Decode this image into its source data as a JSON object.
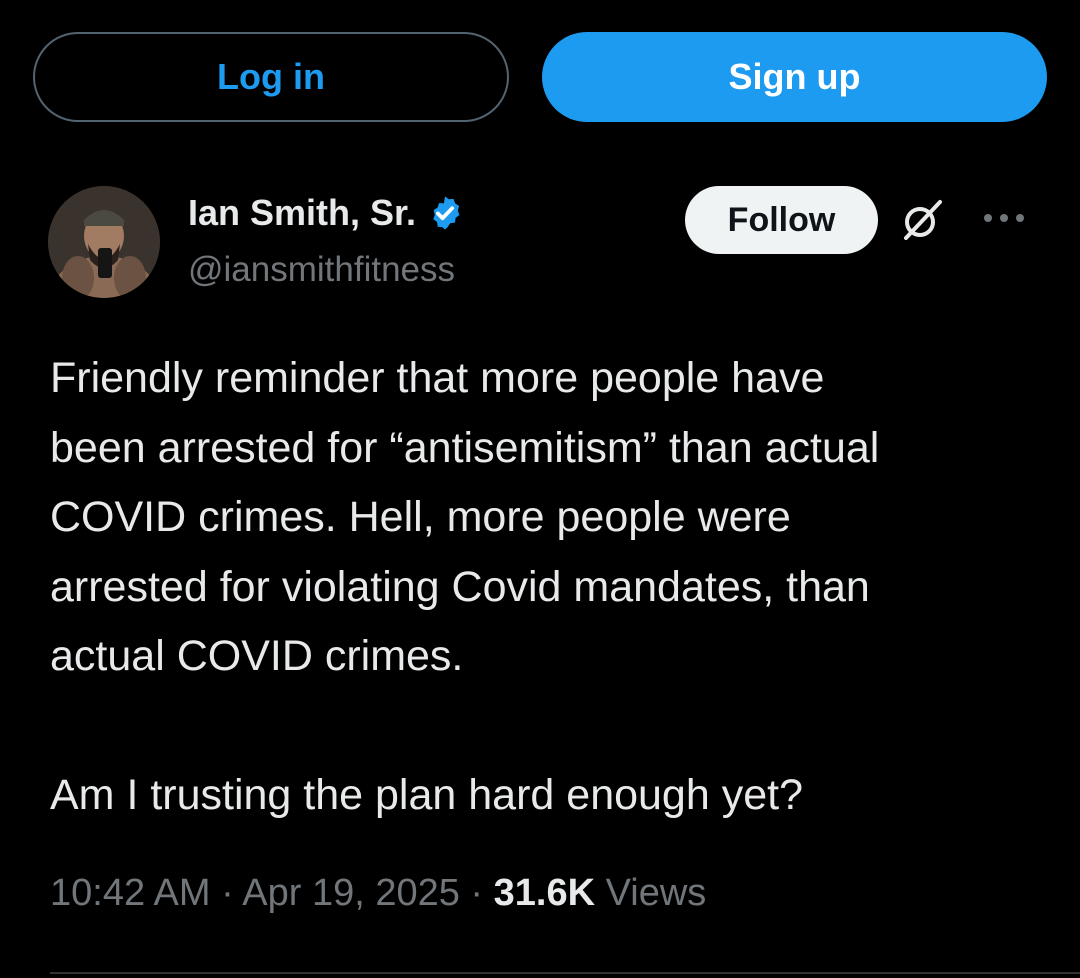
{
  "header": {
    "login_label": "Log in",
    "signup_label": "Sign up"
  },
  "author": {
    "name": "Ian Smith, Sr.",
    "handle": "@iansmithfitness",
    "verified": true
  },
  "actions": {
    "follow_label": "Follow"
  },
  "tweet": {
    "line1": "Friendly reminder that more people have",
    "line2": "been arrested for “antisemitism” than actual",
    "line3": "COVID crimes. Hell, more people were",
    "line4": "arrested for violating Covid mandates, than",
    "line5": "actual COVID crimes.",
    "line6": "",
    "line7": "Am I trusting the plan hard enough yet?"
  },
  "meta": {
    "time": "10:42 AM",
    "separator": "·",
    "date": "Apr 19, 2025",
    "views_count": "31.6K",
    "views_label": "Views"
  },
  "colors": {
    "background": "#000000",
    "accent": "#1d9bf0",
    "text": "#e7e9ea",
    "secondary_text": "#71767b"
  },
  "icons": {
    "verified": "verified-badge-icon",
    "grok": "grok-icon",
    "more": "more-icon"
  }
}
